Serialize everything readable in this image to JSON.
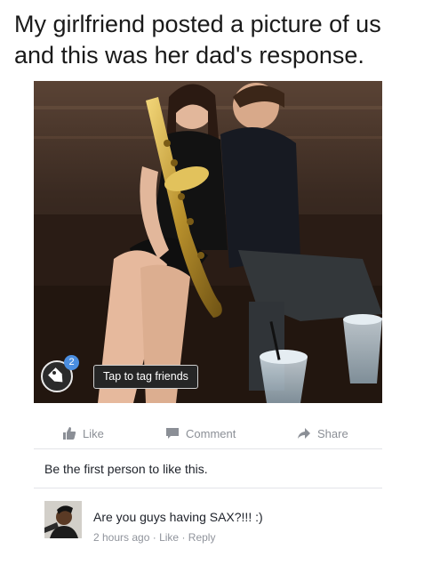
{
  "caption": "My girlfriend posted a picture of us and this was her dad's response.",
  "photo": {
    "alt": "photo",
    "tag_count": "2",
    "tag_prompt": "Tap to tag friends"
  },
  "actions": {
    "like": "Like",
    "comment": "Comment",
    "share": "Share"
  },
  "likes_summary": "Be the first person to like this.",
  "comment": {
    "text": "Are you guys having SAX?!!! :)",
    "time": "2 hours ago",
    "separator": "·",
    "like_link": "Like",
    "reply_link": "Reply"
  },
  "colors": {
    "action_gray": "#8b8f96",
    "meta_gray": "#90949c",
    "tag_blue": "#4b8ee0"
  }
}
